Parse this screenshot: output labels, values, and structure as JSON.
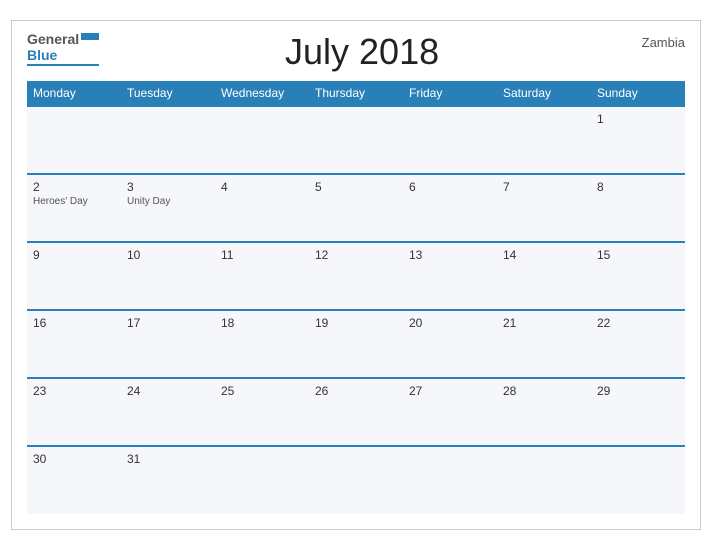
{
  "header": {
    "logo_general": "General",
    "logo_blue": "Blue",
    "title": "July 2018",
    "country": "Zambia"
  },
  "weekdays": [
    "Monday",
    "Tuesday",
    "Wednesday",
    "Thursday",
    "Friday",
    "Saturday",
    "Sunday"
  ],
  "weeks": [
    [
      {
        "day": "",
        "holiday": ""
      },
      {
        "day": "",
        "holiday": ""
      },
      {
        "day": "",
        "holiday": ""
      },
      {
        "day": "",
        "holiday": ""
      },
      {
        "day": "",
        "holiday": ""
      },
      {
        "day": "",
        "holiday": ""
      },
      {
        "day": "1",
        "holiday": ""
      }
    ],
    [
      {
        "day": "2",
        "holiday": "Heroes' Day"
      },
      {
        "day": "3",
        "holiday": "Unity Day"
      },
      {
        "day": "4",
        "holiday": ""
      },
      {
        "day": "5",
        "holiday": ""
      },
      {
        "day": "6",
        "holiday": ""
      },
      {
        "day": "7",
        "holiday": ""
      },
      {
        "day": "8",
        "holiday": ""
      }
    ],
    [
      {
        "day": "9",
        "holiday": ""
      },
      {
        "day": "10",
        "holiday": ""
      },
      {
        "day": "11",
        "holiday": ""
      },
      {
        "day": "12",
        "holiday": ""
      },
      {
        "day": "13",
        "holiday": ""
      },
      {
        "day": "14",
        "holiday": ""
      },
      {
        "day": "15",
        "holiday": ""
      }
    ],
    [
      {
        "day": "16",
        "holiday": ""
      },
      {
        "day": "17",
        "holiday": ""
      },
      {
        "day": "18",
        "holiday": ""
      },
      {
        "day": "19",
        "holiday": ""
      },
      {
        "day": "20",
        "holiday": ""
      },
      {
        "day": "21",
        "holiday": ""
      },
      {
        "day": "22",
        "holiday": ""
      }
    ],
    [
      {
        "day": "23",
        "holiday": ""
      },
      {
        "day": "24",
        "holiday": ""
      },
      {
        "day": "25",
        "holiday": ""
      },
      {
        "day": "26",
        "holiday": ""
      },
      {
        "day": "27",
        "holiday": ""
      },
      {
        "day": "28",
        "holiday": ""
      },
      {
        "day": "29",
        "holiday": ""
      }
    ],
    [
      {
        "day": "30",
        "holiday": ""
      },
      {
        "day": "31",
        "holiday": ""
      },
      {
        "day": "",
        "holiday": ""
      },
      {
        "day": "",
        "holiday": ""
      },
      {
        "day": "",
        "holiday": ""
      },
      {
        "day": "",
        "holiday": ""
      },
      {
        "day": "",
        "holiday": ""
      }
    ]
  ],
  "colors": {
    "header_bg": "#2980b9",
    "cell_bg": "#f5f7fa",
    "border": "#2980b9"
  }
}
